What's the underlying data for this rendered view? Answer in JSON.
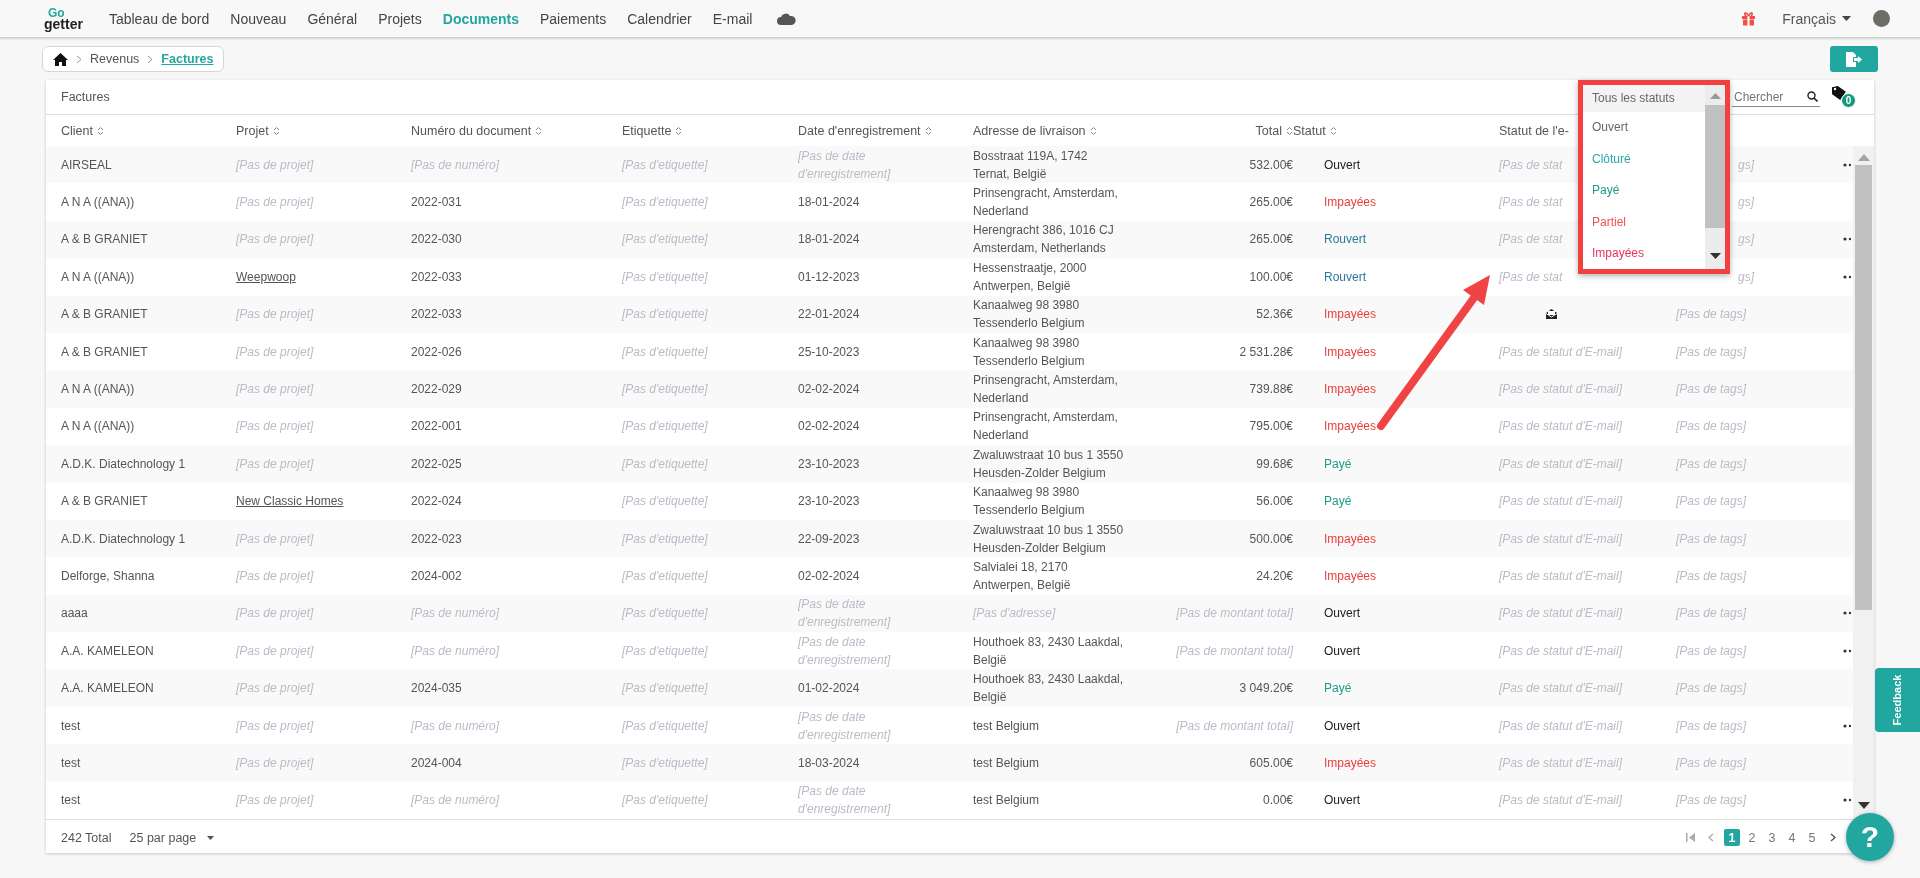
{
  "nav": {
    "logo": {
      "top": "Go",
      "bottom": "getter"
    },
    "items": [
      {
        "label": "Tableau de bord",
        "selected": false
      },
      {
        "label": "Nouveau",
        "selected": false
      },
      {
        "label": "Général",
        "selected": false
      },
      {
        "label": "Projets",
        "selected": false
      },
      {
        "label": "Documents",
        "selected": true
      },
      {
        "label": "Paiements",
        "selected": false
      },
      {
        "label": "Calendrier",
        "selected": false
      },
      {
        "label": "E-mail",
        "selected": false
      }
    ],
    "language": "Français"
  },
  "breadcrumb": [
    {
      "label": "Revenus",
      "selected": false
    },
    {
      "label": "Factures",
      "selected": true
    }
  ],
  "card": {
    "title": "Factures",
    "search": {
      "placeholder": "Chercher"
    },
    "tag_count": "0",
    "status_dropdown": {
      "highlighted": true,
      "value": "Tous les statuts",
      "options": [
        {
          "label": "Ouvert",
          "color": "#666666"
        },
        {
          "label": "Clôturé",
          "color": "#2aa7a7"
        },
        {
          "label": "Payé",
          "color": "#1e9a88"
        },
        {
          "label": "Partiel",
          "color": "#f2504b"
        },
        {
          "label": "Impayées",
          "color": "#e8345a"
        }
      ]
    },
    "columns": [
      {
        "label": "Client",
        "sortable": true
      },
      {
        "label": "Projet",
        "sortable": true
      },
      {
        "label": "Numéro du document",
        "sortable": true
      },
      {
        "label": "Etiquette",
        "sortable": true
      },
      {
        "label": "Date d'enregistrement",
        "sortable": true
      },
      {
        "label": "Adresse de livraison",
        "sortable": true
      },
      {
        "label": "Total",
        "sortable": true
      },
      {
        "label": "Statut",
        "sortable": true
      },
      {
        "label": "Statut de l'e-"
      }
    ],
    "rows": [
      {
        "menu": true,
        "cells": [
          {
            "text": "AIRSEAL",
            "kind": "text"
          },
          {
            "text": "[Pas de projet]",
            "kind": "empty"
          },
          {
            "text": "[Pas de numéro]",
            "kind": "empty"
          },
          {
            "text": "[Pas d'etiquette]",
            "kind": "empty"
          },
          {
            "text": "[Pas de date\nd'enregistrement]",
            "kind": "empty"
          },
          {
            "text": "Bosstraat 119A, 1742\nTernat, België",
            "kind": "text"
          },
          {
            "text": "532.00€",
            "kind": "text"
          },
          {
            "text": "Ouvert",
            "kind": "text",
            "color": "#222222"
          },
          {
            "text": "[Pas de stat",
            "kind": "empty"
          },
          {
            "text": "gs]",
            "kind": "tail"
          }
        ]
      },
      {
        "menu": false,
        "cells": [
          {
            "text": "A N A ((ANA))",
            "kind": "text"
          },
          {
            "text": "[Pas de projet]",
            "kind": "empty"
          },
          {
            "text": "2022-031",
            "kind": "text"
          },
          {
            "text": "[Pas d'etiquette]",
            "kind": "empty"
          },
          {
            "text": "18-01-2024",
            "kind": "text"
          },
          {
            "text": "Prinsengracht, Amsterdam,\nNederland",
            "kind": "text"
          },
          {
            "text": "265.00€",
            "kind": "text"
          },
          {
            "text": "Impayées",
            "kind": "text",
            "color": "#e8413c"
          },
          {
            "text": "[Pas de stat",
            "kind": "empty"
          },
          {
            "text": "gs]",
            "kind": "tail"
          }
        ]
      },
      {
        "menu": true,
        "cells": [
          {
            "text": "A & B GRANIET",
            "kind": "text"
          },
          {
            "text": "[Pas de projet]",
            "kind": "empty"
          },
          {
            "text": "2022-030",
            "kind": "text"
          },
          {
            "text": "[Pas d'etiquette]",
            "kind": "empty"
          },
          {
            "text": "18-01-2024",
            "kind": "text"
          },
          {
            "text": "Herengracht 386, 1016 CJ\nAmsterdam, Netherlands",
            "kind": "text"
          },
          {
            "text": "265.00€",
            "kind": "text"
          },
          {
            "text": "Rouvert",
            "kind": "text",
            "color": "#2b7a99"
          },
          {
            "text": "[Pas de stat",
            "kind": "empty"
          },
          {
            "text": "gs]",
            "kind": "tail"
          }
        ]
      },
      {
        "menu": true,
        "cells": [
          {
            "text": "A N A ((ANA))",
            "kind": "text"
          },
          {
            "text": "Weepwoop",
            "kind": "link"
          },
          {
            "text": "2022-033",
            "kind": "text"
          },
          {
            "text": "[Pas d'etiquette]",
            "kind": "empty"
          },
          {
            "text": "01-12-2023",
            "kind": "text"
          },
          {
            "text": "Hessenstraatje, 2000\nAntwerpen, België",
            "kind": "text"
          },
          {
            "text": "100.00€",
            "kind": "text"
          },
          {
            "text": "Rouvert",
            "kind": "text",
            "color": "#2b7a99"
          },
          {
            "text": "[Pas de stat",
            "kind": "empty"
          },
          {
            "text": "gs]",
            "kind": "tail"
          }
        ]
      },
      {
        "menu": false,
        "cells": [
          {
            "text": "A & B GRANIET",
            "kind": "text"
          },
          {
            "text": "[Pas de projet]",
            "kind": "empty"
          },
          {
            "text": "2022-033",
            "kind": "text"
          },
          {
            "text": "[Pas d'etiquette]",
            "kind": "empty"
          },
          {
            "text": "22-01-2024",
            "kind": "text"
          },
          {
            "text": "Kanaalweg 98 3980\nTessenderlo Belgium",
            "kind": "text"
          },
          {
            "text": "52.36€",
            "kind": "text"
          },
          {
            "text": "Impayées",
            "kind": "text",
            "color": "#e8413c"
          },
          {
            "kind": "mail"
          },
          {
            "text": "[Pas de tags]",
            "kind": "empty"
          }
        ]
      },
      {
        "menu": false,
        "cells": [
          {
            "text": "A & B GRANIET",
            "kind": "text"
          },
          {
            "text": "[Pas de projet]",
            "kind": "empty"
          },
          {
            "text": "2022-026",
            "kind": "text"
          },
          {
            "text": "[Pas d'etiquette]",
            "kind": "empty"
          },
          {
            "text": "25-10-2023",
            "kind": "text"
          },
          {
            "text": "Kanaalweg 98 3980\nTessenderlo Belgium",
            "kind": "text"
          },
          {
            "text": "2 531.28€",
            "kind": "text"
          },
          {
            "text": "Impayées",
            "kind": "text",
            "color": "#e8413c"
          },
          {
            "text": "[Pas de statut d'E-mail]",
            "kind": "empty"
          },
          {
            "text": "[Pas de tags]",
            "kind": "empty"
          }
        ]
      },
      {
        "menu": false,
        "cells": [
          {
            "text": "A N A ((ANA))",
            "kind": "text"
          },
          {
            "text": "[Pas de projet]",
            "kind": "empty"
          },
          {
            "text": "2022-029",
            "kind": "text"
          },
          {
            "text": "[Pas d'etiquette]",
            "kind": "empty"
          },
          {
            "text": "02-02-2024",
            "kind": "text"
          },
          {
            "text": "Prinsengracht, Amsterdam,\nNederland",
            "kind": "text"
          },
          {
            "text": "739.88€",
            "kind": "text"
          },
          {
            "text": "Impayées",
            "kind": "text",
            "color": "#e8413c"
          },
          {
            "text": "[Pas de statut d'E-mail]",
            "kind": "empty"
          },
          {
            "text": "[Pas de tags]",
            "kind": "empty"
          }
        ]
      },
      {
        "menu": false,
        "cells": [
          {
            "text": "A N A ((ANA))",
            "kind": "text"
          },
          {
            "text": "[Pas de projet]",
            "kind": "empty"
          },
          {
            "text": "2022-001",
            "kind": "text"
          },
          {
            "text": "[Pas d'etiquette]",
            "kind": "empty"
          },
          {
            "text": "02-02-2024",
            "kind": "text"
          },
          {
            "text": "Prinsengracht, Amsterdam,\nNederland",
            "kind": "text"
          },
          {
            "text": "795.00€",
            "kind": "text"
          },
          {
            "text": "Impayées",
            "kind": "text",
            "color": "#e8413c"
          },
          {
            "text": "[Pas de statut d'E-mail]",
            "kind": "empty"
          },
          {
            "text": "[Pas de tags]",
            "kind": "empty"
          }
        ]
      },
      {
        "menu": false,
        "cells": [
          {
            "text": "A.D.K. Diatechnology 1",
            "kind": "text"
          },
          {
            "text": "[Pas de projet]",
            "kind": "empty"
          },
          {
            "text": "2022-025",
            "kind": "text"
          },
          {
            "text": "[Pas d'etiquette]",
            "kind": "empty"
          },
          {
            "text": "23-10-2023",
            "kind": "text"
          },
          {
            "text": "Zwaluwstraat 10 bus 1 3550\nHeusden-Zolder Belgium",
            "kind": "text"
          },
          {
            "text": "99.68€",
            "kind": "text"
          },
          {
            "text": "Payé",
            "kind": "text",
            "color": "#1e9a88"
          },
          {
            "text": "[Pas de statut d'E-mail]",
            "kind": "empty"
          },
          {
            "text": "[Pas de tags]",
            "kind": "empty"
          }
        ]
      },
      {
        "menu": false,
        "cells": [
          {
            "text": "A & B GRANIET",
            "kind": "text"
          },
          {
            "text": "New Classic Homes",
            "kind": "link"
          },
          {
            "text": "2022-024",
            "kind": "text"
          },
          {
            "text": "[Pas d'etiquette]",
            "kind": "empty"
          },
          {
            "text": "23-10-2023",
            "kind": "text"
          },
          {
            "text": "Kanaalweg 98 3980\nTessenderlo Belgium",
            "kind": "text"
          },
          {
            "text": "56.00€",
            "kind": "text"
          },
          {
            "text": "Payé",
            "kind": "text",
            "color": "#1e9a88"
          },
          {
            "text": "[Pas de statut d'E-mail]",
            "kind": "empty"
          },
          {
            "text": "[Pas de tags]",
            "kind": "empty"
          }
        ]
      },
      {
        "menu": false,
        "cells": [
          {
            "text": "A.D.K. Diatechnology 1",
            "kind": "text"
          },
          {
            "text": "[Pas de projet]",
            "kind": "empty"
          },
          {
            "text": "2022-023",
            "kind": "text"
          },
          {
            "text": "[Pas d'etiquette]",
            "kind": "empty"
          },
          {
            "text": "22-09-2023",
            "kind": "text"
          },
          {
            "text": "Zwaluwstraat 10 bus 1 3550\nHeusden-Zolder Belgium",
            "kind": "text"
          },
          {
            "text": "500.00€",
            "kind": "text"
          },
          {
            "text": "Impayées",
            "kind": "text",
            "color": "#e8413c"
          },
          {
            "text": "[Pas de statut d'E-mail]",
            "kind": "empty"
          },
          {
            "text": "[Pas de tags]",
            "kind": "empty"
          }
        ]
      },
      {
        "menu": false,
        "cells": [
          {
            "text": "Delforge, Shanna",
            "kind": "text"
          },
          {
            "text": "[Pas de projet]",
            "kind": "empty"
          },
          {
            "text": "2024-002",
            "kind": "text"
          },
          {
            "text": "[Pas d'etiquette]",
            "kind": "empty"
          },
          {
            "text": "02-02-2024",
            "kind": "text"
          },
          {
            "text": "Salvialei 18, 2170\nAntwerpen, België",
            "kind": "text"
          },
          {
            "text": "24.20€",
            "kind": "text"
          },
          {
            "text": "Impayées",
            "kind": "text",
            "color": "#e8413c"
          },
          {
            "text": "[Pas de statut d'E-mail]",
            "kind": "empty"
          },
          {
            "text": "[Pas de tags]",
            "kind": "empty"
          }
        ]
      },
      {
        "menu": true,
        "cells": [
          {
            "text": "aaaa",
            "kind": "text"
          },
          {
            "text": "[Pas de projet]",
            "kind": "empty"
          },
          {
            "text": "[Pas de numéro]",
            "kind": "empty"
          },
          {
            "text": "[Pas d'etiquette]",
            "kind": "empty"
          },
          {
            "text": "[Pas de date\nd'enregistrement]",
            "kind": "empty"
          },
          {
            "text": "[Pas d'adresse]",
            "kind": "empty"
          },
          {
            "text": "[Pas de montant total]",
            "kind": "empty"
          },
          {
            "text": "Ouvert",
            "kind": "text",
            "color": "#222222"
          },
          {
            "text": "[Pas de statut d'E-mail]",
            "kind": "empty"
          },
          {
            "text": "[Pas de tags]",
            "kind": "empty"
          }
        ]
      },
      {
        "menu": true,
        "cells": [
          {
            "text": "A.A. KAMELEON",
            "kind": "text"
          },
          {
            "text": "[Pas de projet]",
            "kind": "empty"
          },
          {
            "text": "[Pas de numéro]",
            "kind": "empty"
          },
          {
            "text": "[Pas d'etiquette]",
            "kind": "empty"
          },
          {
            "text": "[Pas de date\nd'enregistrement]",
            "kind": "empty"
          },
          {
            "text": "Houthoek 83, 2430 Laakdal,\nBelgië",
            "kind": "text"
          },
          {
            "text": "[Pas de montant total]",
            "kind": "empty"
          },
          {
            "text": "Ouvert",
            "kind": "text",
            "color": "#222222"
          },
          {
            "text": "[Pas de statut d'E-mail]",
            "kind": "empty"
          },
          {
            "text": "[Pas de tags]",
            "kind": "empty"
          }
        ]
      },
      {
        "menu": false,
        "cells": [
          {
            "text": "A.A. KAMELEON",
            "kind": "text"
          },
          {
            "text": "[Pas de projet]",
            "kind": "empty"
          },
          {
            "text": "2024-035",
            "kind": "text"
          },
          {
            "text": "[Pas d'etiquette]",
            "kind": "empty"
          },
          {
            "text": "01-02-2024",
            "kind": "text"
          },
          {
            "text": "Houthoek 83, 2430 Laakdal,\nBelgië",
            "kind": "text"
          },
          {
            "text": "3 049.20€",
            "kind": "text"
          },
          {
            "text": "Payé",
            "kind": "text",
            "color": "#1e9a88"
          },
          {
            "text": "[Pas de statut d'E-mail]",
            "kind": "empty"
          },
          {
            "text": "[Pas de tags]",
            "kind": "empty"
          }
        ]
      },
      {
        "menu": true,
        "cells": [
          {
            "text": "test",
            "kind": "text"
          },
          {
            "text": "[Pas de projet]",
            "kind": "empty"
          },
          {
            "text": "[Pas de numéro]",
            "kind": "empty"
          },
          {
            "text": "[Pas d'etiquette]",
            "kind": "empty"
          },
          {
            "text": "[Pas de date\nd'enregistrement]",
            "kind": "empty"
          },
          {
            "text": "test Belgium",
            "kind": "text"
          },
          {
            "text": "[Pas de montant total]",
            "kind": "empty"
          },
          {
            "text": "Ouvert",
            "kind": "text",
            "color": "#222222"
          },
          {
            "text": "[Pas de statut d'E-mail]",
            "kind": "empty"
          },
          {
            "text": "[Pas de tags]",
            "kind": "empty"
          }
        ]
      },
      {
        "menu": false,
        "cells": [
          {
            "text": "test",
            "kind": "text"
          },
          {
            "text": "[Pas de projet]",
            "kind": "empty"
          },
          {
            "text": "2024-004",
            "kind": "text"
          },
          {
            "text": "[Pas d'etiquette]",
            "kind": "empty"
          },
          {
            "text": "18-03-2024",
            "kind": "text"
          },
          {
            "text": "test Belgium",
            "kind": "text"
          },
          {
            "text": "605.00€",
            "kind": "text"
          },
          {
            "text": "Impayées",
            "kind": "text",
            "color": "#e8413c"
          },
          {
            "text": "[Pas de statut d'E-mail]",
            "kind": "empty"
          },
          {
            "text": "[Pas de tags]",
            "kind": "empty"
          }
        ]
      },
      {
        "menu": true,
        "cells": [
          {
            "text": "test",
            "kind": "text"
          },
          {
            "text": "[Pas de projet]",
            "kind": "empty"
          },
          {
            "text": "[Pas de numéro]",
            "kind": "empty"
          },
          {
            "text": "[Pas d'etiquette]",
            "kind": "empty"
          },
          {
            "text": "[Pas de date\nd'enregistrement]",
            "kind": "empty"
          },
          {
            "text": "test Belgium",
            "kind": "text"
          },
          {
            "text": "0.00€",
            "kind": "text"
          },
          {
            "text": "Ouvert",
            "kind": "text",
            "color": "#222222"
          },
          {
            "text": "[Pas de statut d'E-mail]",
            "kind": "empty"
          },
          {
            "text": "[Pas de tags]",
            "kind": "empty"
          }
        ]
      }
    ],
    "footer": {
      "total": "242 Total",
      "per_page": "25 par page",
      "pages": [
        {
          "label": "1",
          "selected": true
        },
        {
          "label": "2",
          "selected": false
        },
        {
          "label": "3",
          "selected": false
        },
        {
          "label": "4",
          "selected": false
        },
        {
          "label": "5",
          "selected": false
        }
      ]
    }
  },
  "annotations": [
    {
      "kind": "arrow"
    }
  ],
  "feedback": "Feedback",
  "help": "?"
}
